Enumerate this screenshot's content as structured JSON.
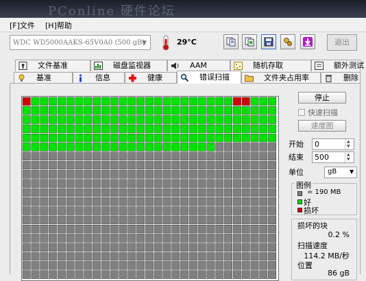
{
  "window": {
    "watermark": "PConline 硬件论坛"
  },
  "menu": {
    "file": "[F]文件",
    "help": "[H]帮助"
  },
  "toolbar": {
    "drive": "WDC WD5000AAKS-65V0A0 (500 gB)",
    "temperature": "29°C",
    "exit_label": "退出",
    "buttons": [
      "copy-info-icon",
      "copy-screenshot-icon",
      "save-icon",
      "options-icon",
      "download-icon"
    ]
  },
  "tabs_row1": [
    "文件基准",
    "磁盘监视器",
    "AAM",
    "随机存取",
    "额外测试"
  ],
  "tabs_row2": [
    "基准",
    "信息",
    "健康",
    "错误扫描",
    "文件夹占用率",
    "删除"
  ],
  "active_tab": "错误扫描",
  "scan": {
    "grid_cols": 29,
    "grid_rows": 20,
    "scanned_blocks": 167,
    "damaged_blocks": [
      0,
      24,
      25
    ],
    "colors": {
      "good": "#00e000",
      "untested": "#808080",
      "damaged": "#d00000"
    }
  },
  "controls": {
    "stop": "停止",
    "quick_scan": "快速扫描",
    "speed_map": "速度图",
    "start_label": "开始",
    "start_value": "0",
    "end_label": "结束",
    "end_value": "500",
    "unit_label": "单位",
    "unit_value": "gB"
  },
  "legend": {
    "title": "图例",
    "block_size": "= 190 MB",
    "good": "好",
    "damaged": "损坏"
  },
  "stats": {
    "damaged_label": "损坏的块",
    "damaged_value": "0.2 %",
    "speed_label": "扫描速度",
    "speed_value": "114.2 MB/秒",
    "position_label": "位置",
    "position_value": "86 gB"
  }
}
